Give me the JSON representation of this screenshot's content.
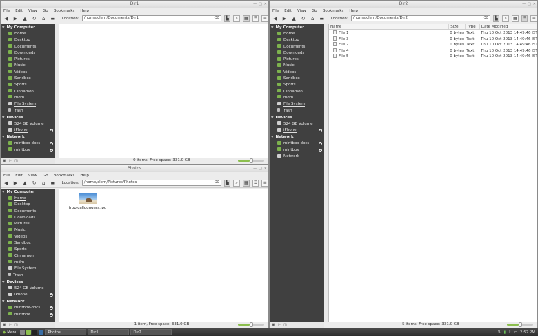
{
  "menu": [
    "File",
    "Edit",
    "View",
    "Go",
    "Bookmarks",
    "Help"
  ],
  "location_label": "Location:",
  "sidebar": {
    "my_computer": "My Computer",
    "places": [
      "Home",
      "Desktop",
      "Documents",
      "Downloads",
      "Pictures",
      "Music",
      "Videos",
      "Sandbox",
      "Sports",
      "Cinnamon",
      "mdm",
      "File System",
      "Trash"
    ],
    "devices_label": "Devices",
    "devices": [
      "524 GB Volume",
      "iPhone"
    ],
    "network_label": "Network",
    "network": [
      "mintbox-docs",
      "mintbox",
      "Network"
    ]
  },
  "dir1": {
    "title": "Dir1",
    "path": "/home/clem/Documents/Dir1",
    "status": "0 items, Free space: 331.0 GB",
    "zoom_level": 0.45
  },
  "photos": {
    "title": "Photos",
    "path": "/home/clem/Pictures/Photos",
    "status": "1 item, Free space: 331.0 GB",
    "file": "tropicalloungers.jpg",
    "zoom_level": 0.45
  },
  "dir2": {
    "title": "Dir2",
    "path": "/home/clem/Documents/Dir2",
    "status": "5 items, Free space: 331.0 GB",
    "columns": [
      "Name",
      "Size",
      "Type",
      "Date Modified"
    ],
    "files": [
      {
        "name": "File 1",
        "size": "0 bytes",
        "type": "Text",
        "date": "Thu 10 Oct 2013 14:49:46 IST"
      },
      {
        "name": "File 3",
        "size": "0 bytes",
        "type": "Text",
        "date": "Thu 10 Oct 2013 14:49:46 IST"
      },
      {
        "name": "File 2",
        "size": "0 bytes",
        "type": "Text",
        "date": "Thu 10 Oct 2013 14:49:46 IST"
      },
      {
        "name": "File 4",
        "size": "0 bytes",
        "type": "Text",
        "date": "Thu 10 Oct 2013 14:49:46 IST"
      },
      {
        "name": "File 5",
        "size": "0 bytes",
        "type": "Text",
        "date": "Thu 10 Oct 2013 14:49:46 IST"
      }
    ],
    "zoom_level": 0.45
  },
  "taskbar": {
    "menu_label": "Menu",
    "windows": [
      "Photos",
      "Dir1",
      "Dir2"
    ],
    "clock": "2:52 PM"
  },
  "colors": {
    "sidebar_bg": "#404040",
    "folder_green": "#7db24d",
    "accent": "#8cbf4e"
  }
}
